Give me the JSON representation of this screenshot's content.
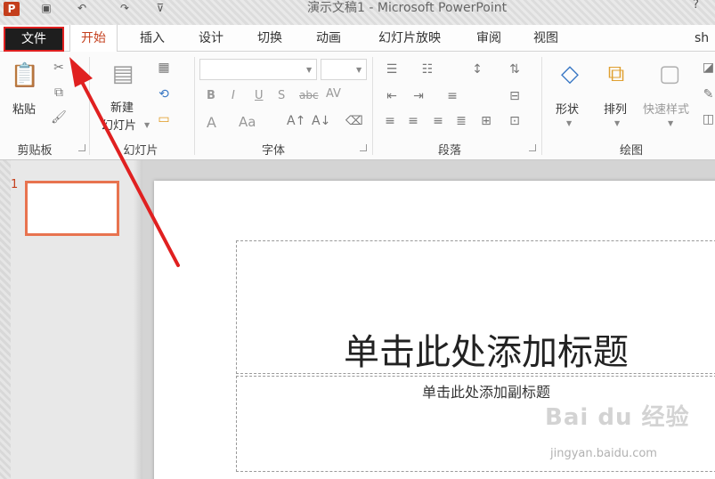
{
  "titlebar": {
    "app_icon": "P",
    "qat_icons": [
      "save-icon",
      "undo-icon",
      "redo-icon",
      "customize-icon"
    ],
    "title": "演示文稿1 - Microsoft PowerPoint",
    "help": "?"
  },
  "tabs": [
    {
      "id": "file",
      "label": "文件"
    },
    {
      "id": "home",
      "label": "开始"
    },
    {
      "id": "insert",
      "label": "插入"
    },
    {
      "id": "design",
      "label": "设计"
    },
    {
      "id": "transitions",
      "label": "切换"
    },
    {
      "id": "animations",
      "label": "动画"
    },
    {
      "id": "slideshow",
      "label": "幻灯片放映"
    },
    {
      "id": "review",
      "label": "审阅"
    },
    {
      "id": "view",
      "label": "视图"
    },
    {
      "id": "more",
      "label": "sh"
    }
  ],
  "ribbon": {
    "clipboard": {
      "label": "剪贴板",
      "paste": "粘贴"
    },
    "slides": {
      "label": "幻灯片",
      "new_slide_1": "新建",
      "new_slide_2": "幻灯片"
    },
    "font": {
      "label": "字体",
      "bold": "B",
      "italic": "I",
      "underline": "U",
      "shadow": "S",
      "strike": "abc",
      "spacing": "AV",
      "font_color": "A",
      "change_case": "Aa"
    },
    "paragraph": {
      "label": "段落"
    },
    "drawing": {
      "label": "绘图",
      "shapes": "形状",
      "arrange": "排列",
      "quick_styles": "快速样式"
    }
  },
  "thumbnails": [
    {
      "number": "1"
    }
  ],
  "slide": {
    "title_placeholder": "单击此处添加标题",
    "subtitle_placeholder": "单击此处添加副标题"
  },
  "watermark": {
    "main": "Bai du 经验",
    "url": "jingyan.baidu.com"
  },
  "colors": {
    "accent": "#c43e1c",
    "file_tab": "#1e1e1e",
    "highlight": "#e02020",
    "thumb_border": "#e8734f"
  }
}
